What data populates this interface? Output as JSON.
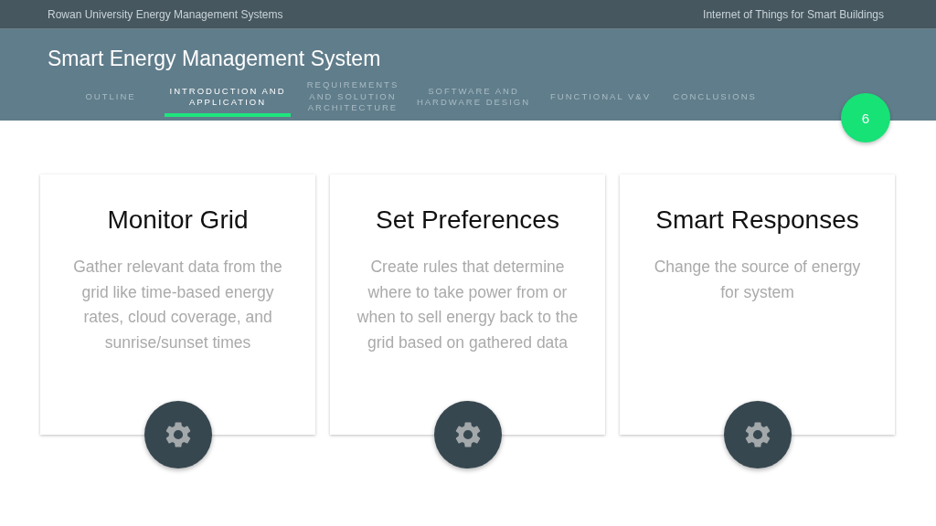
{
  "top_bar": {
    "left": "Rowan University Energy Management Systems",
    "right": "Internet of Things for Smart Buildings"
  },
  "header": {
    "title": "Smart Energy Management System"
  },
  "tabs": [
    {
      "label": "OUTLINE",
      "selected": false
    },
    {
      "label": "INTRODUCTION AND APPLICATION",
      "selected": true
    },
    {
      "label": "REQUIREMENTS AND SOLUTION ARCHITECTURE",
      "selected": false
    },
    {
      "label": "SOFTWARE AND HARDWARE DESIGN",
      "selected": false
    },
    {
      "label": "FUNCTIONAL V&V",
      "selected": false
    },
    {
      "label": "CONCLUSIONS",
      "selected": false
    }
  ],
  "page_number": "6",
  "cards": [
    {
      "title": "Monitor Grid",
      "text": "Gather relevant data from the grid like time-based energy rates, cloud coverage, and sunrise/sunset times"
    },
    {
      "title": "Set Preferences",
      "text": "Create rules that determine where to take power from or when to sell energy back to the grid based on gathered data"
    },
    {
      "title": "Smart Responses",
      "text": "Change the source of energy for system"
    }
  ]
}
